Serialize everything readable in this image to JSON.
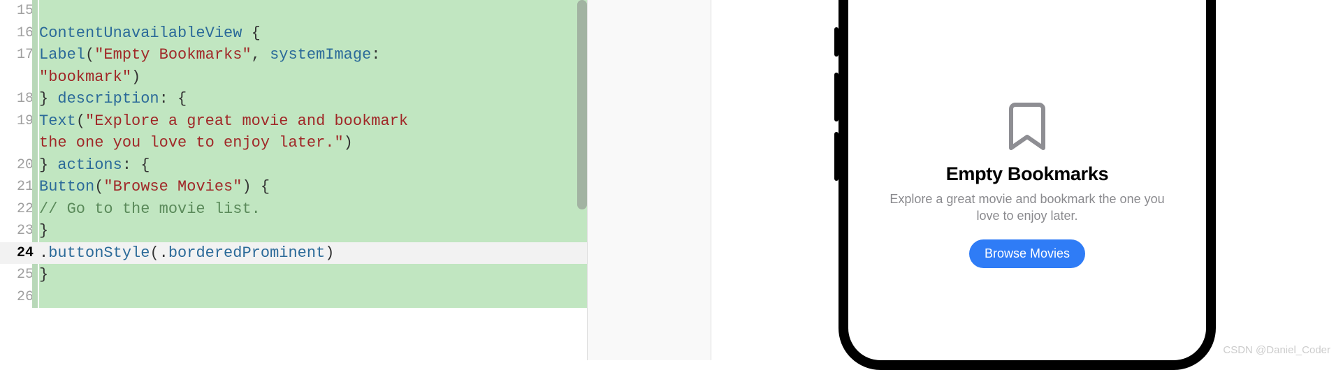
{
  "editor": {
    "lines": [
      {
        "num": "15",
        "highlighted": true,
        "current": false
      },
      {
        "num": "16",
        "highlighted": true,
        "current": false
      },
      {
        "num": "17",
        "highlighted": true,
        "current": false
      },
      {
        "num": "",
        "highlighted": true,
        "current": false
      },
      {
        "num": "18",
        "highlighted": true,
        "current": false
      },
      {
        "num": "19",
        "highlighted": true,
        "current": false
      },
      {
        "num": "",
        "highlighted": true,
        "current": false
      },
      {
        "num": "20",
        "highlighted": true,
        "current": false
      },
      {
        "num": "21",
        "highlighted": true,
        "current": false
      },
      {
        "num": "22",
        "highlighted": true,
        "current": false
      },
      {
        "num": "23",
        "highlighted": true,
        "current": false
      },
      {
        "num": "24",
        "highlighted": false,
        "current": true
      },
      {
        "num": "25",
        "highlighted": true,
        "current": false
      },
      {
        "num": "26",
        "highlighted": true,
        "current": false
      }
    ],
    "code": {
      "l15": "",
      "l16_type": "ContentUnavailableView",
      "l16_brace": " {",
      "l17_type": "Label",
      "l17_open": "(",
      "l17_str": "\"Empty Bookmarks\"",
      "l17_comma": ", ",
      "l17_param": "systemImage",
      "l17_colon": ":",
      "l17b_str": "\"bookmark\"",
      "l17b_close": ")",
      "l18_close": "} ",
      "l18_param": "description",
      "l18_brace": ": {",
      "l19_type": "Text",
      "l19_open": "(",
      "l19_str": "\"Explore a great movie and bookmark",
      "l19b_str": "the one you love to enjoy later.\"",
      "l19b_close": ")",
      "l20_close": "} ",
      "l20_param": "actions",
      "l20_brace": ": {",
      "l21_type": "Button",
      "l21_open": "(",
      "l21_str": "\"Browse Movies\"",
      "l21_close": ") {",
      "l22_comment": "// Go to the movie list.",
      "l23_close": "}",
      "l24_dot": ".",
      "l24_method": "buttonStyle",
      "l24_open": "(.",
      "l24_enum": "borderedProminent",
      "l24_close": ")",
      "l25_close": "}"
    }
  },
  "preview": {
    "title": "Empty Bookmarks",
    "description": "Explore a great movie and bookmark the one you love to enjoy later.",
    "button_label": "Browse Movies"
  },
  "watermark": "CSDN @Daniel_Coder"
}
